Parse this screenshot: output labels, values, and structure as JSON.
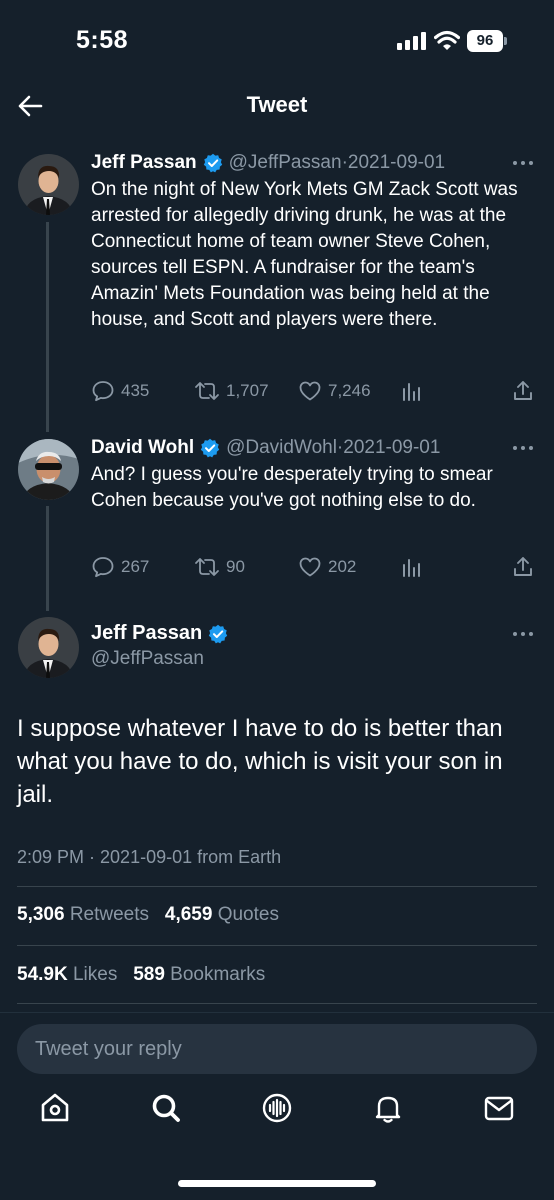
{
  "status_bar": {
    "time": "5:58",
    "battery": "96"
  },
  "header": {
    "title": "Tweet"
  },
  "thread": [
    {
      "name": "Jeff Passan",
      "handle": "@JeffPassan",
      "date": "2021-09-01",
      "text": "On the night of New York Mets GM Zack Scott was arrested for allegedly driving drunk, he was at the Connecticut home of team owner Steve Cohen, sources tell ESPN. A fundraiser for the team's Amazin' Mets Foundation was being held at the house, and Scott and players were there.",
      "replies": "435",
      "retweets": "1,707",
      "likes": "7,246"
    },
    {
      "name": "David Wohl",
      "handle": "@DavidWohl",
      "date": "2021-09-01",
      "text": "And? I guess you're desperately trying to smear Cohen because you've got nothing else to do.",
      "replies": "267",
      "retweets": "90",
      "likes": "202"
    }
  ],
  "main_tweet": {
    "name": "Jeff Passan",
    "handle": "@JeffPassan",
    "text": "I suppose whatever I have to do is better than what you have to do, which is visit your son in jail.",
    "timestamp": "2:09 PM · 2021-09-01 from Earth",
    "retweets_count": "5,306",
    "retweets_label": "Retweets",
    "quotes_count": "4,659",
    "quotes_label": "Quotes",
    "likes_count": "54.9K",
    "likes_label": "Likes",
    "bookmarks_count": "589",
    "bookmarks_label": "Bookmarks"
  },
  "reply": {
    "placeholder": "Tweet your reply"
  },
  "tab_bar": [
    "home-icon",
    "search-icon",
    "spaces-icon",
    "notifications-icon",
    "messages-icon"
  ],
  "colors": {
    "background": "#15202b",
    "muted": "#8b98a5",
    "verified": "#1d9bf0",
    "divider": "#38444d"
  }
}
